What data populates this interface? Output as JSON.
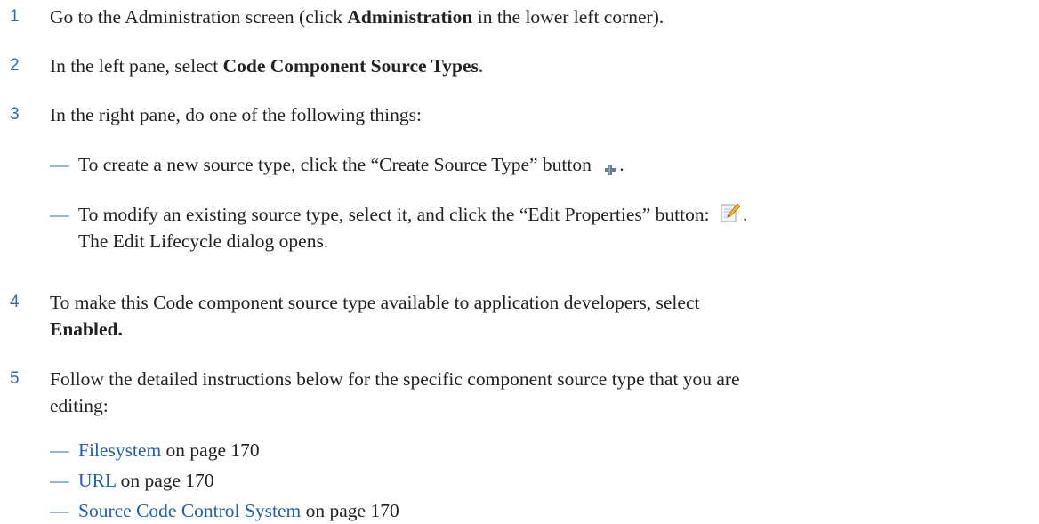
{
  "steps": [
    {
      "number": "1",
      "before": "Go to the Administration screen (click ",
      "bold": "Administration",
      "after": " in the lower left corner)."
    },
    {
      "number": "2",
      "before": "In the left pane, select ",
      "bold": "Code Component Source Types",
      "after": "."
    },
    {
      "number": "3",
      "text": "In the right pane, do one of the following things:",
      "options": [
        {
          "dash": "—",
          "before": "To create a new source type, click the “Create Source Type” button ",
          "icon": "plus-icon",
          "after": "."
        },
        {
          "dash": "—",
          "before": "To modify an existing source type, select it, and click the “Edit Properties” button: ",
          "icon": "edit-properties-icon",
          "after": ".",
          "line2": "The Edit Lifecycle dialog opens."
        }
      ]
    },
    {
      "number": "4",
      "before": "To make this Code component source type available to application developers, select",
      "bold": "Enabled."
    },
    {
      "number": "5",
      "line1": "Follow the detailed instructions below for the specific component source type that you are",
      "line2": "editing:",
      "links": [
        {
          "dash": "—",
          "label": "Filesystem",
          "suffix": " on page 170"
        },
        {
          "dash": "—",
          "label": "URL",
          "suffix": " on page 170"
        },
        {
          "dash": "—",
          "label": "Source Code Control System",
          "suffix": " on page 170"
        }
      ]
    }
  ],
  "colors": {
    "step_number": "#2b6cb8",
    "link": "#1f5fb4",
    "text": "#222222"
  }
}
